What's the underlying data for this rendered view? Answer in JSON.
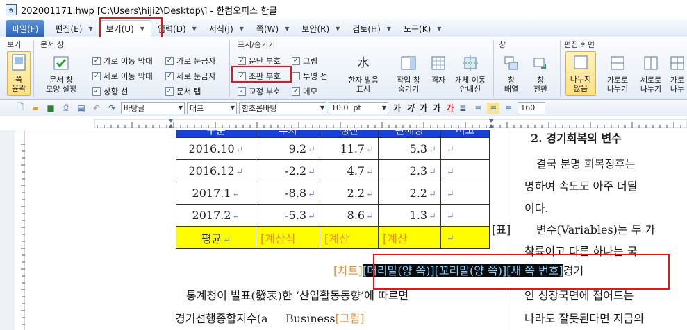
{
  "window": {
    "title": "202001171.hwp [C:\\Users\\hiji2\\Desktop\\] - 한컴오피스 한글",
    "app_icon": "hwp-icon"
  },
  "menu": [
    {
      "label": "파일(F)",
      "caret": false
    },
    {
      "label": "편집(E)",
      "caret": true
    },
    {
      "label": "보기(U)",
      "caret": true
    },
    {
      "label": "입력(D)",
      "caret": true
    },
    {
      "label": "서식(J)",
      "caret": true
    },
    {
      "label": "쪽(W)",
      "caret": true
    },
    {
      "label": "보안(R)",
      "caret": true
    },
    {
      "label": "검토(H)",
      "caret": true
    },
    {
      "label": "도구(K)",
      "caret": true
    }
  ],
  "ribbon": {
    "groups": {
      "view": "보기",
      "doc_window": "문서 창",
      "show_hide": "표시/숨기기",
      "window": "창",
      "edit_screen": "편집 화면"
    },
    "buttons": {
      "page_outline": "쪽\n윤곽",
      "doc_window_mode": "문서 창\n모양 설정",
      "hanja_reading": "한자 발음\n표시",
      "hide_work_window": "작업 창\n숨기기",
      "grid": "격자",
      "object_move_guide": "개체 이동\n안내선",
      "window_arrange": "창\n배열",
      "window_switch": "창\n전환",
      "no_split": "나누지\n않음",
      "horizontal_split": "가로로\n나누기",
      "vertical_split": "세로로\n나누기",
      "both_split": "가로\n나누"
    },
    "checkboxes": [
      {
        "label": "가로 이동 막대",
        "checked": true
      },
      {
        "label": "세로 이동 막대",
        "checked": true
      },
      {
        "label": "상황 선",
        "checked": true
      },
      {
        "label": "가로 눈금자",
        "checked": true
      },
      {
        "label": "세로 눈금자",
        "checked": true
      },
      {
        "label": "문서 탭",
        "checked": true
      },
      {
        "label": "문단 부호",
        "checked": true
      },
      {
        "label": "조판 부호",
        "checked": true
      },
      {
        "label": "교정 부호",
        "checked": true
      },
      {
        "label": "그림",
        "checked": true
      },
      {
        "label": "투명 선",
        "checked": false
      },
      {
        "label": "메모",
        "checked": true
      }
    ]
  },
  "format_toolbar": {
    "style": "바탕글",
    "lang": "대표",
    "font": "함초롬바탕",
    "size": "10.0",
    "unit": "pt",
    "bold": "가",
    "italic": "가",
    "underline": "가",
    "strike": "가",
    "color": "가",
    "line_spacing": "160"
  },
  "document": {
    "table": {
      "headers": [
        "구분",
        "투자",
        "생산",
        "판매량",
        "비고"
      ],
      "rows": [
        [
          "2016.10",
          "9.2",
          "11.7",
          "5.3",
          ""
        ],
        [
          "2016.12",
          "-2.2",
          "4.7",
          "2.3",
          ""
        ],
        [
          "2017.1",
          "-8.8",
          "2.2",
          "2.2",
          ""
        ],
        [
          "2017.2",
          "-5.3",
          "8.6",
          "1.3",
          ""
        ]
      ],
      "avg_row": [
        "평균",
        "[계산식",
        "[계산",
        "[계산",
        ""
      ]
    },
    "chart_marker": "[차트]",
    "selected_codes": "[머리말(양 쪽)][꼬리말(양 쪽)][새 쪽 번호]",
    "after_sel": "경기",
    "left_line1": "통계청이 발표(發表)한 ‘산업활동동향’에 따르면",
    "left_line2a": "경기선행종합지수(a",
    "left_line2b": "Business",
    "pic_marker": "[그림]",
    "right_heading": "2. 경기회복의 변수",
    "right_lines": [
      "결국 분명 회복징후는",
      "명하여 속도도 아주 더딜",
      "이다.",
      "변수(Variables)는 두 가",
      "착륙이고 다른 하나는 국",
      "인 성장국면에 접어드는",
      "나라도 잘못된다면 지금의"
    ],
    "table_marker": "[표]"
  }
}
